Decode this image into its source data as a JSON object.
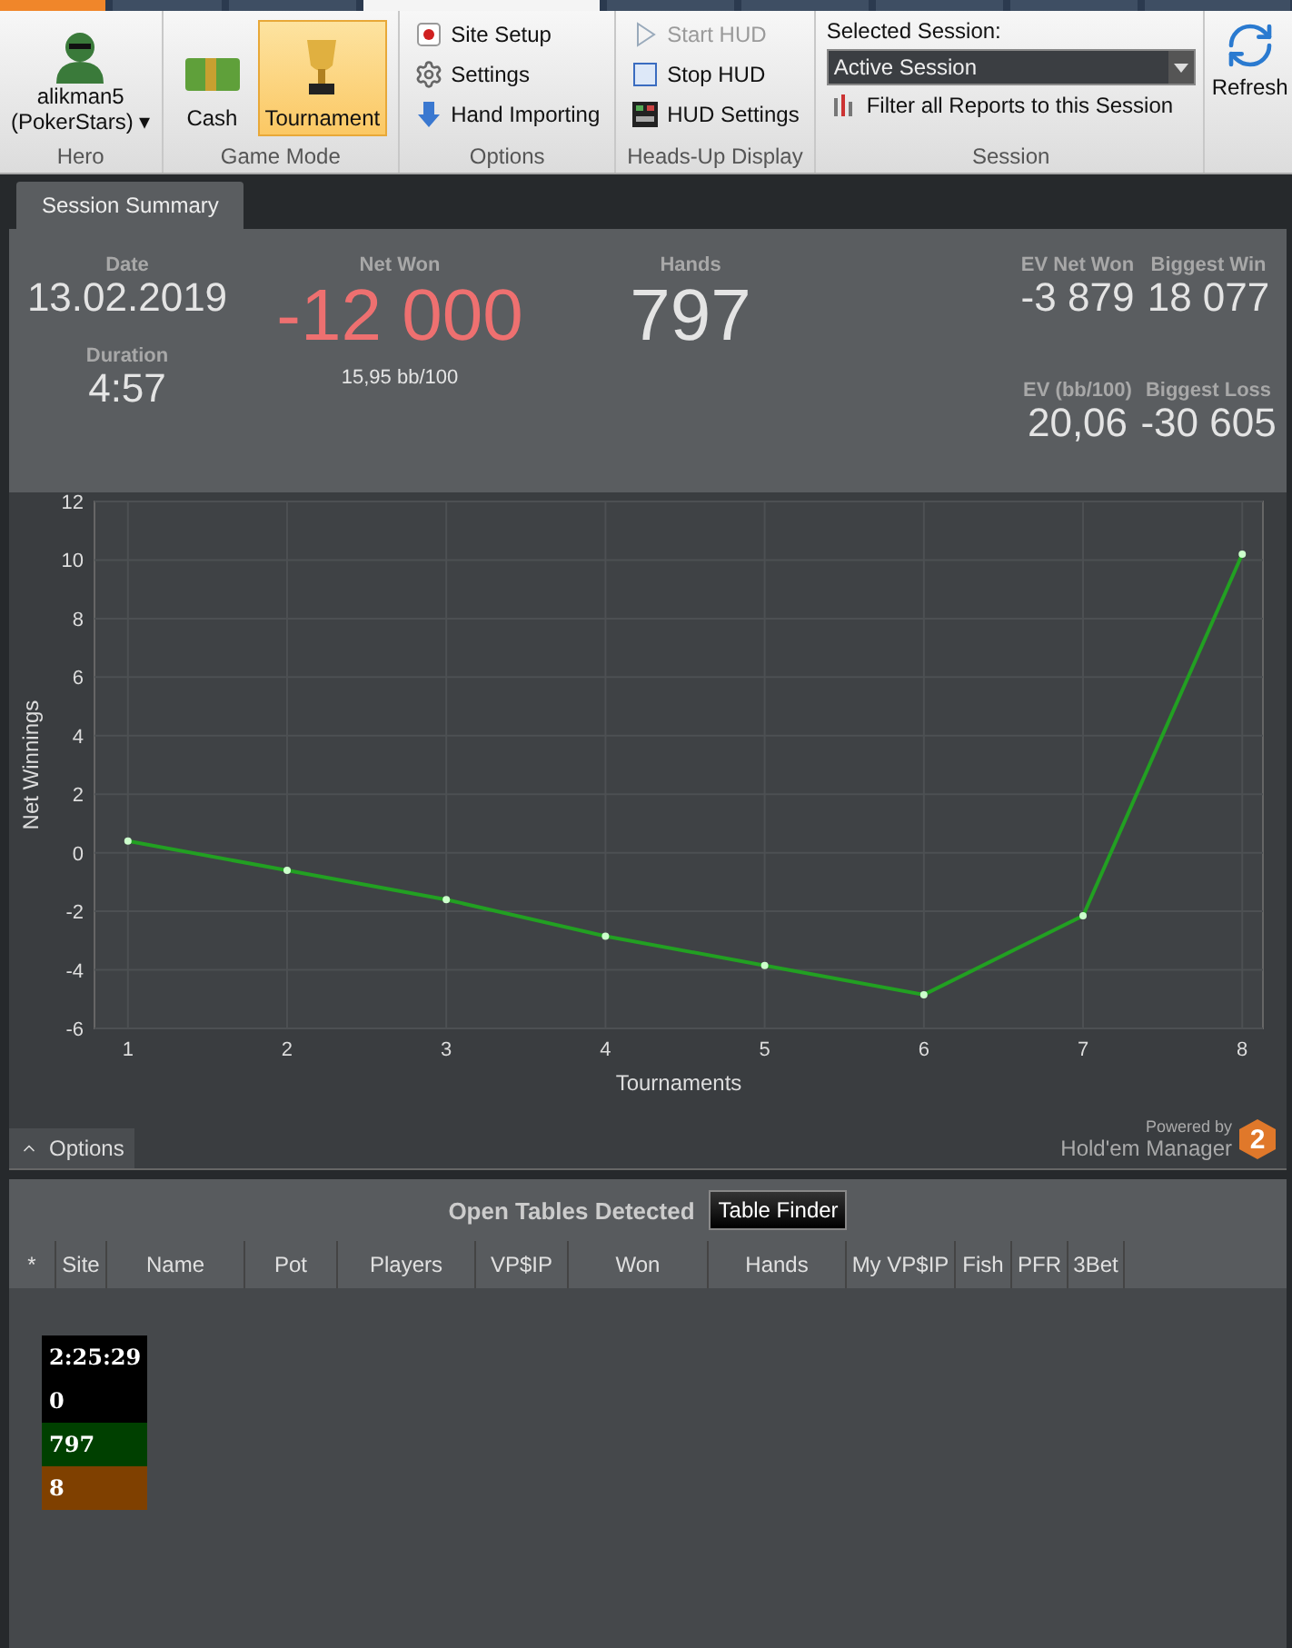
{
  "ribbon": {
    "hero": {
      "name": "alikman5",
      "site": "(PokerStars)",
      "dropdown": "▾",
      "caption": "Hero"
    },
    "game_mode": {
      "caption": "Game Mode",
      "buttons": [
        {
          "label": "Cash",
          "kind": "cash",
          "selected": false
        },
        {
          "label": "Tournament",
          "kind": "trophy",
          "selected": true
        }
      ]
    },
    "options": {
      "caption": "Options",
      "items": [
        {
          "label": "Site Setup",
          "kind": "site"
        },
        {
          "label": "Settings",
          "kind": "gear"
        },
        {
          "label": "Hand Importing",
          "kind": "import"
        }
      ]
    },
    "hud": {
      "caption": "Heads-Up Display",
      "items": [
        {
          "label": "Start HUD",
          "kind": "start",
          "disabled": true
        },
        {
          "label": "Stop HUD",
          "kind": "stop",
          "disabled": false
        },
        {
          "label": "HUD Settings",
          "kind": "hudsettings",
          "disabled": false
        }
      ]
    },
    "session": {
      "caption": "Session",
      "label": "Selected Session:",
      "value": "Active Session",
      "filter": "Filter all Reports to this Session"
    },
    "refresh": "Refresh"
  },
  "summary_tab": "Session Summary",
  "summary": {
    "date_label": "Date",
    "date": "13.02.2019",
    "duration_label": "Duration",
    "duration": "4:57",
    "net_won_label": "Net Won",
    "net_won": "-12 000",
    "bb100": "15,95 bb/100",
    "hands_label": "Hands",
    "hands": "797",
    "stats": [
      {
        "label": "EV Net Won",
        "value": "-3 879"
      },
      {
        "label": "Biggest Win",
        "value": "18 077"
      },
      {
        "label": "EV (bb/100)",
        "value": "20,06"
      },
      {
        "label": "Biggest Loss",
        "value": "-30 605"
      }
    ]
  },
  "chart": {
    "chart_data": {
      "type": "line",
      "xlabel": "Tournaments",
      "ylabel": "Net Winnings",
      "x": [
        1,
        2,
        3,
        4,
        5,
        6,
        7,
        8
      ],
      "grid": true,
      "series": [
        {
          "color": "#22a022",
          "marker": true,
          "values": [
            0.4,
            -0.6,
            -1.6,
            -2.85,
            -3.85,
            -4.85,
            -2.15,
            10.2
          ]
        }
      ],
      "xlim": [
        0.79,
        8.13
      ],
      "ylim": [
        -6,
        12
      ],
      "xticks": [
        1,
        2,
        3,
        4,
        5,
        6,
        7,
        8
      ],
      "yticks": [
        -6,
        -4,
        -2,
        0,
        2,
        4,
        6,
        8,
        10,
        12
      ]
    },
    "powered_by": "Powered by",
    "brand": "Hold'em Manager",
    "logo": "2",
    "options_button": "Options"
  },
  "open_tables": {
    "title": "Open Tables Detected",
    "finder_button": "Table Finder",
    "columns": [
      "*",
      "Site",
      "Name",
      "Pot",
      "Players",
      "VP$IP",
      "Won",
      "Hands",
      "My VP$IP",
      "Fish",
      "PFR",
      "3Bet"
    ],
    "hud_rows": [
      {
        "text": "2:25:29",
        "color": "#000000"
      },
      {
        "text": "0",
        "color": "#000000"
      },
      {
        "text": "797",
        "color": "#004000"
      },
      {
        "text": "8",
        "color": "#7f4000"
      }
    ]
  }
}
